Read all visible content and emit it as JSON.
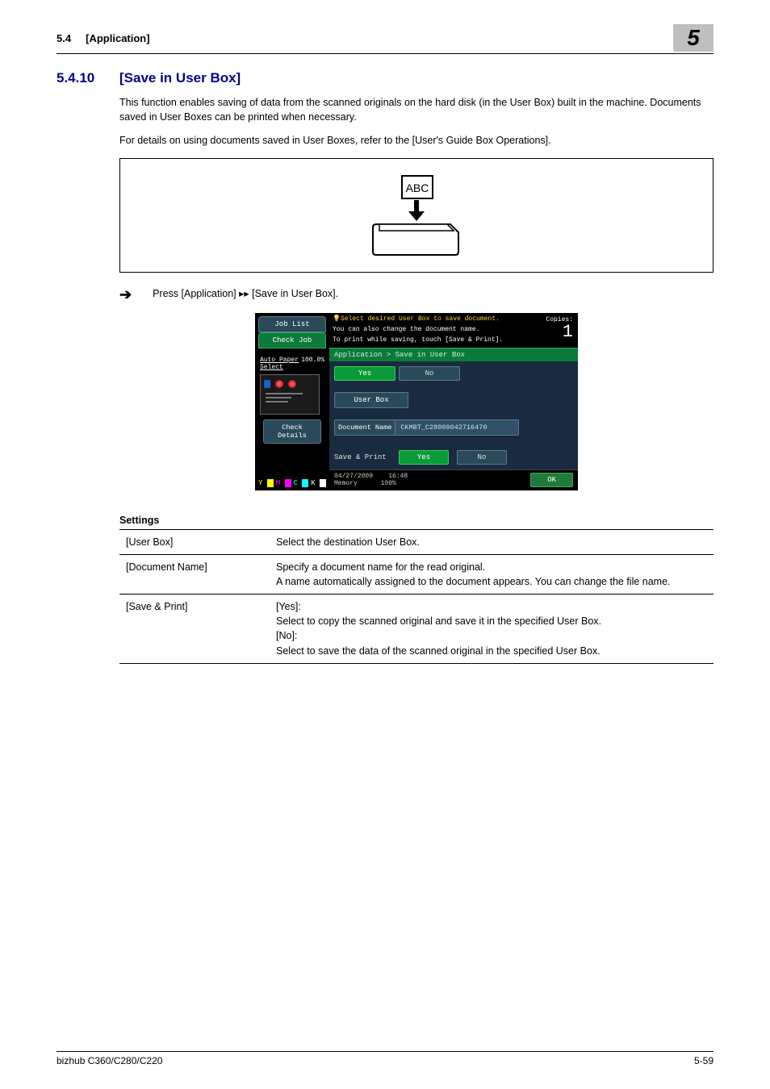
{
  "header": {
    "section_ref": "5.4",
    "section_ref_title": "[Application]",
    "chapter_number": "5"
  },
  "section": {
    "number": "5.4.10",
    "title": "[Save in User Box]"
  },
  "paragraphs": {
    "p1": "This function enables saving of data from the scanned originals on the hard disk (in the User Box) built in the machine. Documents saved in User Boxes can be printed when necessary.",
    "p2": "For details on using documents saved in User Boxes, refer to the [User's Guide Box Operations]."
  },
  "figure": {
    "doc_label": "ABC"
  },
  "step": "Press [Application] ▸▸ [Save in User Box].",
  "screenshot": {
    "job_list": "Job List",
    "check_job": "Check Job",
    "auto_paper": "Auto Paper Select",
    "zoom": "100.0%",
    "check_details": "Check Details",
    "helper1": "Select desired User Box to save document.",
    "helper2": "You can also change the document name.",
    "helper3": "To print while saving, touch [Save & Print].",
    "copies_label": "Copies:",
    "copies_value": "1",
    "breadcrumb": "Application > Save in User Box",
    "yes": "Yes",
    "no": "No",
    "user_box": "User Box",
    "doc_name_label": "Document Name",
    "doc_name_value": "CKMBT_C28009042716470",
    "save_print": "Save & Print",
    "footer_date": "04/27/2009",
    "footer_time": "16:48",
    "footer_mem_label": "Memory",
    "footer_mem_value": "100%",
    "ok": "OK"
  },
  "settings": {
    "heading": "Settings",
    "rows": [
      {
        "label": "[User Box]",
        "desc": "Select the destination User Box."
      },
      {
        "label": "[Document Name]",
        "desc": "Specify a document name for the read original.\nA name automatically assigned to the document appears. You can change the file name."
      },
      {
        "label": "[Save & Print]",
        "desc": "[Yes]:\nSelect to copy the scanned original and save it in the specified User Box.\n[No]:\nSelect to save the data of the scanned original in the specified User Box."
      }
    ]
  },
  "footer": {
    "left": "bizhub C360/C280/C220",
    "right": "5-59"
  }
}
